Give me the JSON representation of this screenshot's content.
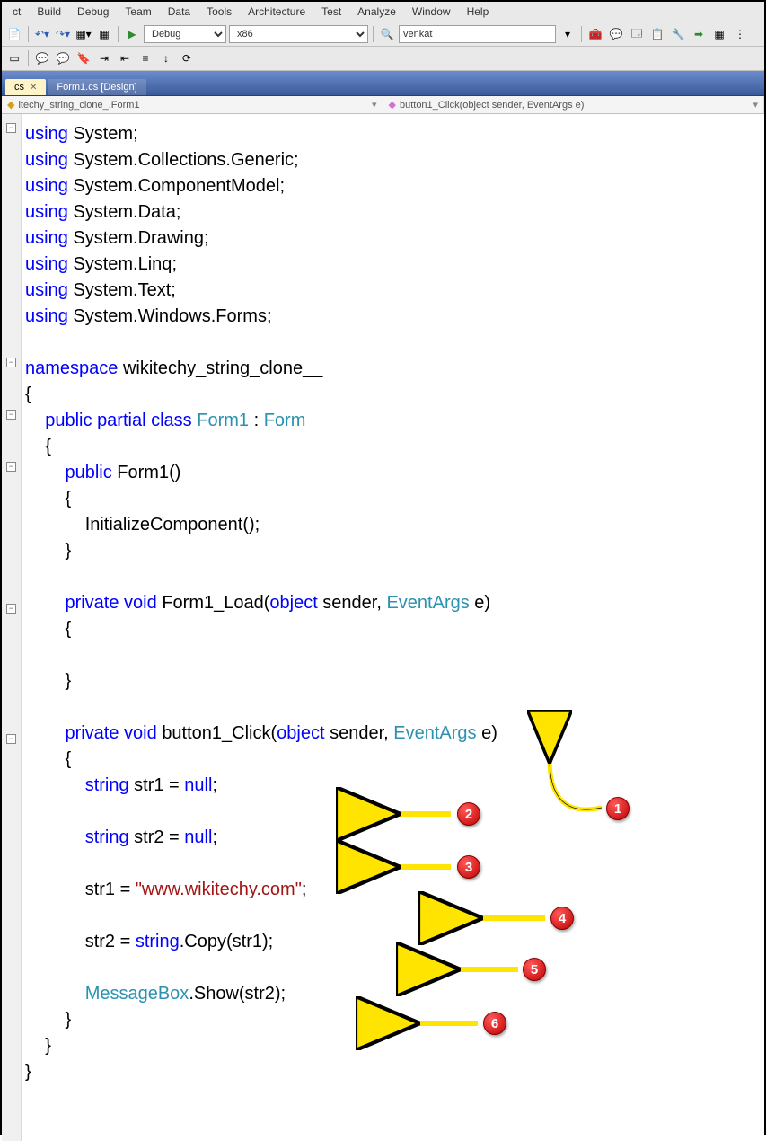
{
  "menu": [
    "ct",
    "Build",
    "Debug",
    "Team",
    "Data",
    "Tools",
    "Architecture",
    "Test",
    "Analyze",
    "Window",
    "Help"
  ],
  "toolbar": {
    "config": "Debug",
    "platform": "x86",
    "search": "venkat"
  },
  "tabs": {
    "t1": "cs",
    "t2": "Form1.cs [Design]"
  },
  "nav": {
    "left": "itechy_string_clone_.Form1",
    "right": "button1_Click(object sender, EventArgs e)"
  },
  "code": {
    "u": "using",
    "ns": "namespace",
    "pub": "public",
    "par": "partial",
    "cls": "class",
    "prv": "private",
    "vd": "void",
    "obj": "object",
    "str_t": "string",
    "nul": "null",
    "sys": "System",
    "cg": "System.Collections.Generic",
    "cm": "System.ComponentModel",
    "dt": "System.Data",
    "dr": "System.Drawing",
    "lq": "System.Linq",
    "tx": "System.Text",
    "wf": "System.Windows.Forms",
    "nsn": "wikitechy_string_clone__",
    "f1": "Form1",
    "frm": "Form",
    "f1c": "Form1()",
    "init": "InitializeComponent();",
    "fl": "Form1_Load(",
    "bc": "button1_Click(",
    "snd": " sender, ",
    "ea": "EventArgs",
    "ee": " e)",
    "s1": " str1 = ",
    "s2": " str2 = ",
    "semi": ";",
    "s1a": "str1 = ",
    "lit": "\"www.wikitechy.com\"",
    "s2a": "str2 = ",
    "cpy": ".Copy(str1);",
    "mb": "MessageBox",
    "shw": ".Show(str2);"
  },
  "annotations": {
    "n1": "1",
    "n2": "2",
    "n3": "3",
    "n4": "4",
    "n5": "5",
    "n6": "6"
  }
}
